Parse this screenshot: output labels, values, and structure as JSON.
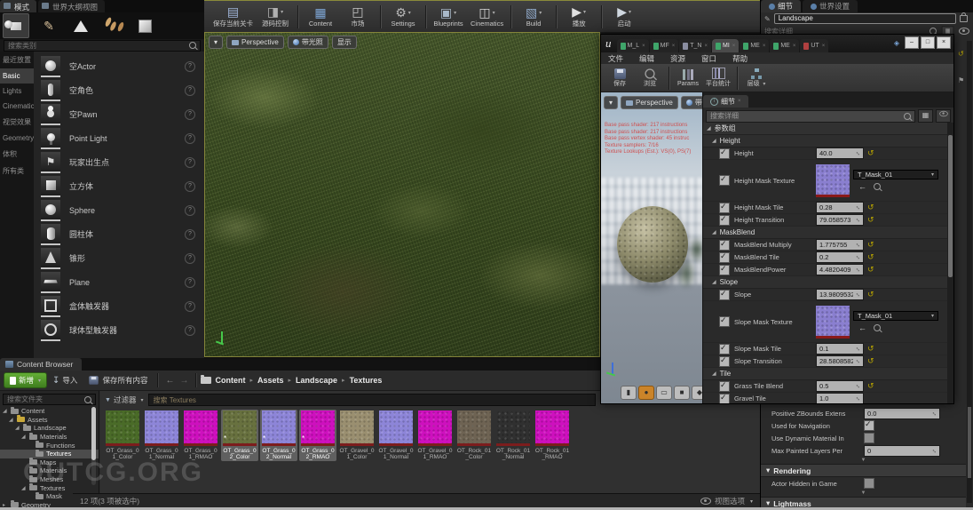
{
  "left_panel": {
    "tabs": [
      {
        "label": "模式",
        "active": true
      },
      {
        "label": "世界大纲视图",
        "active": false
      }
    ],
    "mode_buttons": [
      "place-mode",
      "paint-mode",
      "landscape-mode",
      "foliage-mode",
      "geometry-mode"
    ],
    "search_placeholder": "搜索类别",
    "categories": [
      {
        "label": "最近放置",
        "active": false
      },
      {
        "label": "Basic",
        "active": true
      },
      {
        "label": "Lights",
        "active": false
      },
      {
        "label": "Cinematic",
        "active": false
      },
      {
        "label": "视觉效果",
        "active": false
      },
      {
        "label": "Geometry",
        "active": false
      },
      {
        "label": "体积",
        "active": false
      },
      {
        "label": "所有类",
        "active": false
      }
    ],
    "items": [
      {
        "label": "空Actor",
        "icon": "sphere"
      },
      {
        "label": "空角色",
        "icon": "character"
      },
      {
        "label": "空Pawn",
        "icon": "pawn"
      },
      {
        "label": "Point Light",
        "icon": "light"
      },
      {
        "label": "玩家出生点",
        "icon": "playerstart"
      },
      {
        "label": "立方体",
        "icon": "cube"
      },
      {
        "label": "Sphere",
        "icon": "sphere"
      },
      {
        "label": "圆柱体",
        "icon": "cylinder"
      },
      {
        "label": "锥形",
        "icon": "cone"
      },
      {
        "label": "Plane",
        "icon": "plane"
      },
      {
        "label": "盒体触发器",
        "icon": "boxtrigger"
      },
      {
        "label": "球体型触发器",
        "icon": "spheretrigger"
      }
    ]
  },
  "main_toolbar": {
    "buttons": [
      {
        "label": "保存当前关卡",
        "icon": "floppy"
      },
      {
        "label": "源码控制",
        "icon": "source",
        "dropdown": true,
        "sep_after": true
      },
      {
        "label": "Content",
        "icon": "grid"
      },
      {
        "label": "市场",
        "icon": "market",
        "sep_after": true
      },
      {
        "label": "Settings",
        "icon": "gear",
        "dropdown": true,
        "sep_after": true
      },
      {
        "label": "Blueprints",
        "icon": "gamepad",
        "dropdown": true
      },
      {
        "label": "Cinematics",
        "icon": "clapper",
        "dropdown": true,
        "sep_after": true
      },
      {
        "label": "Build",
        "icon": "build",
        "dropdown": true,
        "sep_after": true
      },
      {
        "label": "播放",
        "icon": "play",
        "dropdown": true,
        "sep_after": true
      },
      {
        "label": "启动",
        "icon": "launch",
        "dropdown": true
      }
    ]
  },
  "viewport": {
    "buttons": [
      {
        "label": "Perspective",
        "icon": "cam"
      },
      {
        "label": "带光照",
        "icon": "lit"
      },
      {
        "label": "显示",
        "icon": null
      }
    ]
  },
  "material_window": {
    "asset_tabs": [
      {
        "label": "M_L",
        "color": "#3fa56a",
        "active": false
      },
      {
        "label": "MF",
        "color": "#3fa56a",
        "active": false
      },
      {
        "label": "T_N",
        "color": "#8a8da0",
        "active": false
      },
      {
        "label": "MI",
        "color": "#3fa56a",
        "active": true
      },
      {
        "label": "ME",
        "color": "#3fa56a",
        "active": false
      },
      {
        "label": "ME",
        "color": "#3fa56a",
        "active": false
      },
      {
        "label": "UT",
        "color": "#b04040",
        "active": false
      }
    ],
    "window_controls": [
      "–",
      "□",
      "×"
    ],
    "menu": [
      "文件",
      "编辑",
      "资源",
      "窗口",
      "帮助"
    ],
    "toolbar": [
      {
        "label": "保存",
        "icon": "floppy"
      },
      {
        "label": "浏览",
        "icon": "mag",
        "sep_after": true
      },
      {
        "label": "Params",
        "icon": "params"
      },
      {
        "label": "平台统计",
        "icon": "stats",
        "sep_after": true
      },
      {
        "label": "层级",
        "icon": "hier",
        "dropdown": true
      }
    ],
    "preview": {
      "buttons": [
        "Perspective",
        "带光"
      ],
      "stats": [
        "Base pass shader: 217 instructions",
        "Base pass shader: 217 instructions",
        "Base pass vertex shader: 45 instruc",
        "Texture samplers: 7/16",
        "Texture Lookups (Est.): VS(0), PS(7)"
      ],
      "shapes": [
        "cylinder",
        "sphere",
        "plane",
        "cube",
        "teapot"
      ],
      "active_shape": 1
    },
    "details": {
      "tab": "细节",
      "search_placeholder": "搜索详细",
      "root_group": "参数组",
      "groups": [
        {
          "name": "Height",
          "rows": [
            {
              "label": "Height",
              "value": "40.0",
              "checked": true,
              "reset": true
            },
            {
              "label": "Height Mask Texture",
              "texture": "T_Mask_01",
              "checked": true
            },
            {
              "label": "Height Mask Tile",
              "value": "0.28",
              "checked": true,
              "reset": true
            },
            {
              "label": "Height Transition",
              "value": "79.058573",
              "checked": true,
              "reset": true
            }
          ]
        },
        {
          "name": "MaskBlend",
          "rows": [
            {
              "label": "MaskBlend Multiply",
              "value": "1.775755",
              "checked": true,
              "reset": true
            },
            {
              "label": "MaskBlend Tile",
              "value": "0.2",
              "checked": true,
              "reset": true
            },
            {
              "label": "MaskBlendPower",
              "value": "4.4820409",
              "checked": true,
              "reset": true
            }
          ]
        },
        {
          "name": "Slope",
          "rows": [
            {
              "label": "Slope",
              "value": "13.9809532",
              "checked": true,
              "reset": true
            },
            {
              "label": "Slope Mask Texture",
              "texture": "T_Mask_01",
              "checked": true
            },
            {
              "label": "Slope Mask Tile",
              "value": "0.1",
              "checked": true,
              "reset": true
            },
            {
              "label": "Slope Transition",
              "value": "28.5808582",
              "checked": true,
              "reset": true
            }
          ]
        },
        {
          "name": "Tile",
          "rows": [
            {
              "label": "Grass Tile Blend",
              "value": "0.5",
              "checked": true,
              "reset": true
            },
            {
              "label": "Gravel Tile",
              "value": "1.0",
              "checked": true,
              "reset": false
            }
          ]
        }
      ]
    }
  },
  "right_panel": {
    "tabs": [
      {
        "label": "细节",
        "active": true
      },
      {
        "label": "世界设置",
        "active": false
      }
    ],
    "name_field": "Landscape",
    "search_placeholder": "搜索详细",
    "rows": [
      {
        "label": "Positive ZBounds Extens",
        "value": "0.0"
      },
      {
        "label": "Used for Navigation",
        "checkbox": true,
        "checked": true
      },
      {
        "label": "Use Dynamic Material In",
        "checkbox": true,
        "checked": false
      },
      {
        "label": "Max Painted Layers Per",
        "value": "0"
      }
    ],
    "sections": [
      {
        "name": "Rendering",
        "rows": [
          {
            "label": "Actor Hidden in Game",
            "checkbox": true,
            "checked": false
          }
        ]
      },
      {
        "name": "Lightmass",
        "rows": []
      }
    ]
  },
  "content_browser": {
    "tab": "Content Browser",
    "add_button": "新增",
    "import_button": "导入",
    "save_all_button": "保存所有内容",
    "breadcrumb": [
      "Content",
      "Assets",
      "Landscape",
      "Textures"
    ],
    "folder_search_placeholder": "搜索文件夹",
    "filters_label": "过滤器",
    "asset_search_placeholder": "搜索 Textures",
    "tree": [
      {
        "label": "Content",
        "depth": 0,
        "state": "open"
      },
      {
        "label": "Assets",
        "depth": 1,
        "state": "open",
        "folder": "yellow"
      },
      {
        "label": "Landscape",
        "depth": 2,
        "state": "open"
      },
      {
        "label": "Materials",
        "depth": 3,
        "state": "open"
      },
      {
        "label": "Functions",
        "depth": 4,
        "state": "leaf"
      },
      {
        "label": "Textures",
        "depth": 4,
        "state": "leaf",
        "selected": true
      },
      {
        "label": "Maps",
        "depth": 3,
        "state": "leaf"
      },
      {
        "label": "Materials",
        "depth": 3,
        "state": "leaf"
      },
      {
        "label": "Meshes",
        "depth": 3,
        "state": "leaf"
      },
      {
        "label": "Textures",
        "depth": 3,
        "state": "open"
      },
      {
        "label": "Mask",
        "depth": 4,
        "state": "leaf"
      },
      {
        "label": "Geometry",
        "depth": 0,
        "state": "closed"
      }
    ],
    "assets": [
      {
        "name": "OT_Grass_01_Color",
        "kind": "grass1",
        "selected": false,
        "dirty": false
      },
      {
        "name": "OT_Grass_01_Normal",
        "kind": "normal",
        "selected": false,
        "dirty": false
      },
      {
        "name": "OT_Grass_01_RMAO",
        "kind": "rmao",
        "selected": false,
        "dirty": false
      },
      {
        "name": "OT_Grass_02_Color",
        "kind": "grass2",
        "selected": true,
        "dirty": true
      },
      {
        "name": "OT_Grass_02_Normal",
        "kind": "normal",
        "selected": true,
        "dirty": true
      },
      {
        "name": "OT_Grass_02_RMAO",
        "kind": "rmao",
        "selected": true,
        "dirty": true
      },
      {
        "name": "OT_Gravel_01_Color",
        "kind": "gravel",
        "selected": false,
        "dirty": false
      },
      {
        "name": "OT_Gravel_01_Normal",
        "kind": "normal",
        "selected": false,
        "dirty": false
      },
      {
        "name": "OT_Gravel_01_RMAO",
        "kind": "rmao",
        "selected": false,
        "dirty": false
      },
      {
        "name": "OT_Rock_01_Color",
        "kind": "rock",
        "selected": false,
        "dirty": false
      },
      {
        "name": "OT_Rock_01_Normal",
        "kind": "rocknormal",
        "selected": false,
        "dirty": false
      },
      {
        "name": "OT_Rock_01_RMAO",
        "kind": "rmao",
        "selected": false,
        "dirty": false
      }
    ],
    "status": "12 项(3 项被选中)",
    "view_options_label": "视图选项",
    "watermark": "OUTCG.ORG"
  },
  "colors": {
    "accent_green": "#4e9e2e",
    "selection_gray": "#606060",
    "value_box": "#b2b2b2",
    "reset_yellow": "#b8a400",
    "stats_red": "#cf5050",
    "viewport_border": "#84843a"
  }
}
